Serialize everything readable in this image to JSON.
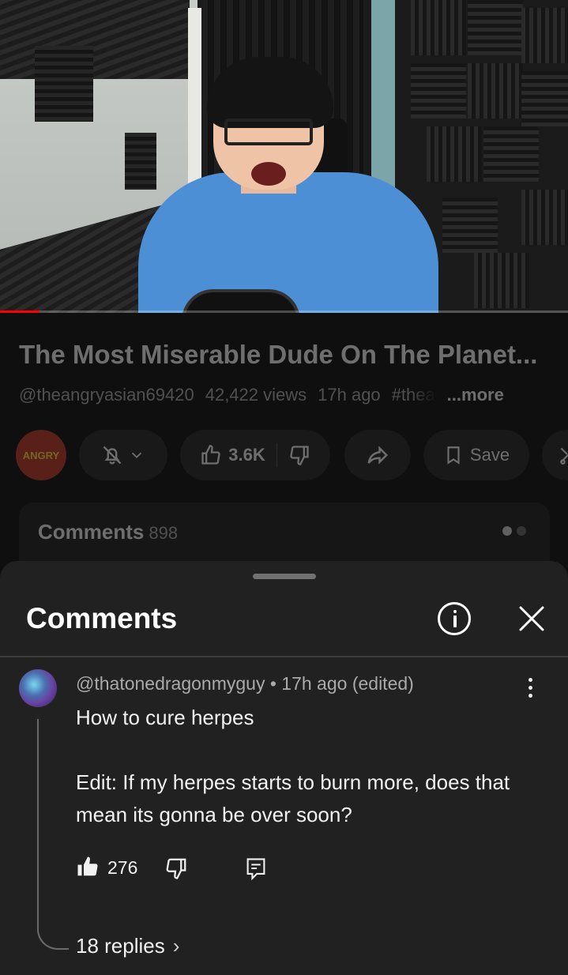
{
  "video": {
    "progress_fraction": 0.07
  },
  "details": {
    "title": "The Most Miserable Dude On The Planet...",
    "channel_handle": "@theangryasian69420",
    "views": "42,422 views",
    "age": "17h ago",
    "hashtag": "#thea",
    "more_label": "...more",
    "channel_avatar_text": "ANGRY"
  },
  "actions": {
    "likes": "3.6K",
    "save_label": "Save"
  },
  "comments_card": {
    "label": "Comments",
    "count": "898"
  },
  "sheet": {
    "title": "Comments"
  },
  "comment": {
    "author": "@thatonedragonmyguy",
    "separator": "•",
    "time": "17h ago (edited)",
    "line1": "How to cure herpes",
    "line2": "Edit: If my herpes starts to burn more, does that mean its gonna be over soon?",
    "like_count": "276",
    "replies_label": "18 replies",
    "replies_chevron": "›"
  },
  "colors": {
    "background": "#0f0f0f",
    "sheet": "#212121",
    "progress": "#ff0000",
    "muted_text": "#aaaaaa"
  }
}
